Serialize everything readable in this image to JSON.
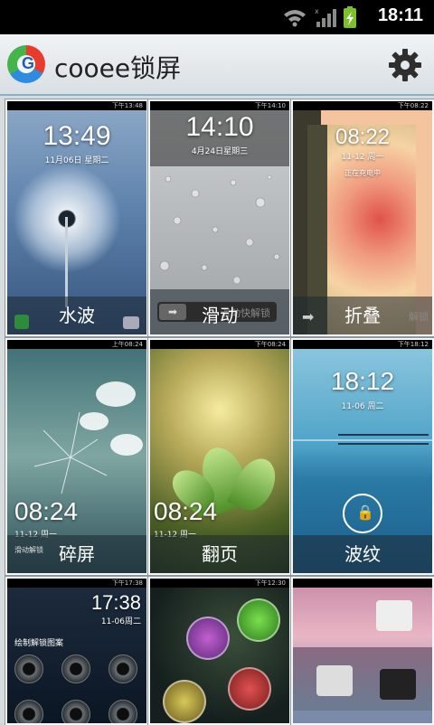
{
  "status_bar": {
    "time": "18:11"
  },
  "app": {
    "title": "cooee锁屏",
    "logo_letter": "G"
  },
  "tiles": [
    {
      "label": "水波",
      "clock": "13:49",
      "date": "11月06日 星期二",
      "mini_time": "下午13:48"
    },
    {
      "label": "滑动",
      "clock": "14:10",
      "date": "4月24日星期三",
      "mini_time": "下午14:10",
      "slider_text": "滑动快解锁"
    },
    {
      "label": "折叠",
      "clock": "08:22",
      "date": "11-12 周一",
      "mini_time": "下午08:22",
      "extra_text": "正在充电中",
      "fold_hint": "解锁"
    },
    {
      "label": "碎屏",
      "clock": "08:24",
      "date": "11-12 周一",
      "mini_time": "上午08:24",
      "extra_text": "滑动解锁"
    },
    {
      "label": "翻页",
      "clock": "08:24",
      "date": "11-12 周一",
      "mini_time": "下午08:24"
    },
    {
      "label": "波纹",
      "clock": "18:12",
      "date": "11-06 周二",
      "mini_time": "下午18:12"
    },
    {
      "label": "",
      "clock": "17:38",
      "date": "11-06周二",
      "mini_time": "下午17:38",
      "extra_text": "绘制解锁图案"
    },
    {
      "label": "",
      "clock": "",
      "date": "",
      "mini_time": "下午12:30"
    },
    {
      "label": "",
      "clock": "",
      "date": "",
      "mini_time": ""
    }
  ],
  "colors": {
    "appbar_border": "#8bb0c8",
    "status_bg": "#000000"
  }
}
